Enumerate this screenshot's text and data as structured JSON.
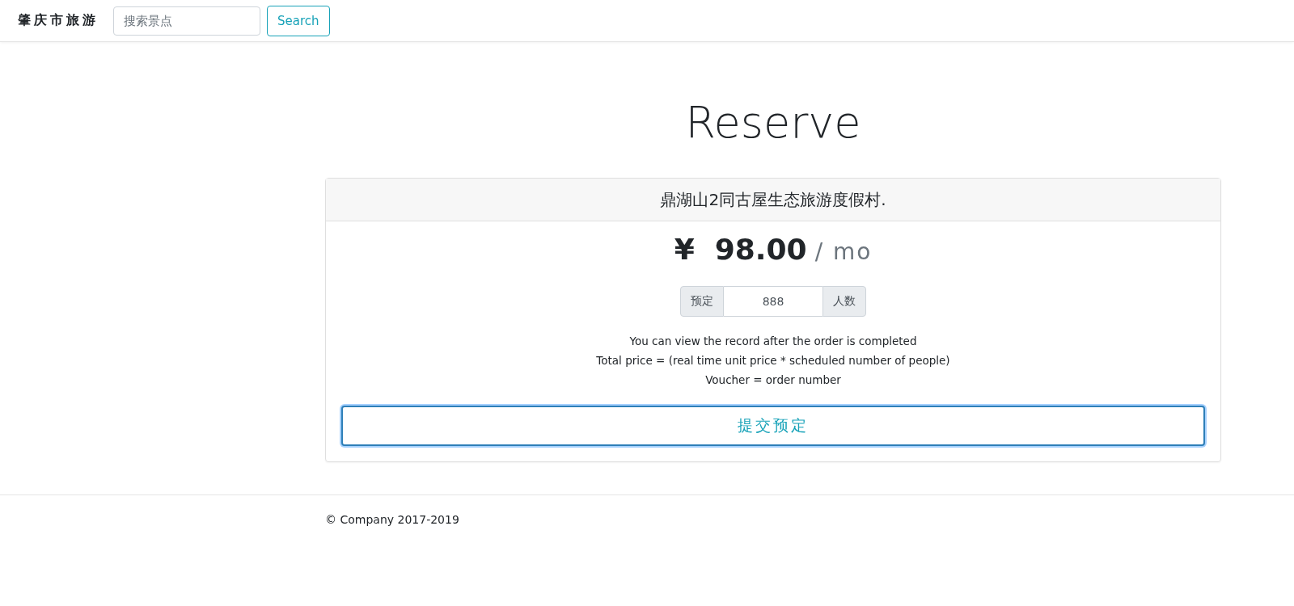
{
  "navbar": {
    "brand": "肇庆市旅游",
    "search": {
      "placeholder": "搜索景点"
    },
    "search_button": "Search"
  },
  "heading": "Reserve",
  "card": {
    "title": "鼎湖山2同古屋生态旅游度假村.",
    "currency": "¥",
    "price": "98.00",
    "period": "/ mo",
    "quantity": {
      "prefix": "预定",
      "value": "888",
      "suffix": "人数"
    },
    "notes": [
      "You can view the record after the order is completed",
      "Total price = (real time unit price * scheduled number of people)",
      "Voucher = order number"
    ],
    "submit_button": "提交预定"
  },
  "footer": "© Company 2017-2019"
}
